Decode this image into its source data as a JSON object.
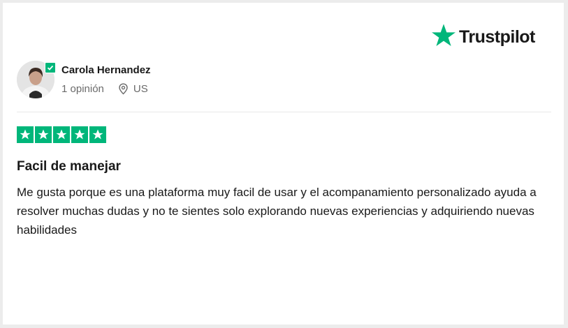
{
  "brand": {
    "name": "Trustpilot",
    "icon": "trustpilot-star-icon",
    "color": "#00b67a"
  },
  "reviewer": {
    "name": "Carola Hernandez",
    "reviews_count": "1 opinión",
    "location": "US",
    "avatar": "avatar-photo",
    "verified_icon": "verified-check-icon",
    "location_icon": "location-pin-icon"
  },
  "review": {
    "rating": 5,
    "rating_max": 5,
    "star_color": "#00b67a",
    "title": "Facil de manejar",
    "body": "Me gusta porque es una plataforma muy facil de usar y el acompanamiento personalizado ayuda a resolver muchas dudas y no te sientes solo explorando nuevas experiencias y adquiriendo nuevas habilidades"
  }
}
